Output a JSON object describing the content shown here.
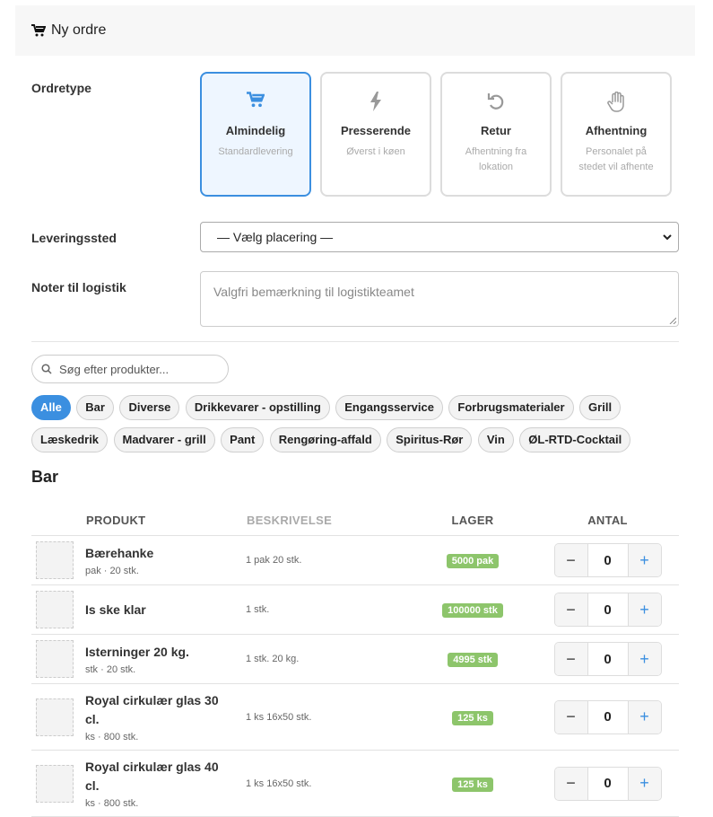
{
  "header": {
    "title": "Ny ordre"
  },
  "order_type": {
    "label": "Ordretype",
    "options": [
      {
        "title": "Almindelig",
        "subtitle": "Standardlevering",
        "icon": "cart-icon",
        "active": true
      },
      {
        "title": "Presserende",
        "subtitle": "Øverst i køen",
        "icon": "lightning-icon",
        "active": false
      },
      {
        "title": "Retur",
        "subtitle": "Afhentning fra lokation",
        "icon": "undo-icon",
        "active": false
      },
      {
        "title": "Afhentning",
        "subtitle": "Personalet på stedet vil afhente",
        "icon": "hand-icon",
        "active": false
      }
    ]
  },
  "delivery": {
    "label": "Leveringssted",
    "selected": "— Vælg placering —"
  },
  "notes": {
    "label": "Noter til logistik",
    "placeholder": "Valgfri bemærkning til logistikteamet"
  },
  "search": {
    "placeholder": "Søg efter produkter..."
  },
  "categories": [
    "Alle",
    "Bar",
    "Diverse",
    "Drikkevarer - opstilling",
    "Engangsservice",
    "Forbrugsmaterialer",
    "Grill",
    "Læskedrik",
    "Madvarer - grill",
    "Pant",
    "Rengøring-affald",
    "Spiritus-Rør",
    "Vin",
    "ØL-RTD-Cocktail"
  ],
  "active_category": "Alle",
  "section": {
    "title": "Bar"
  },
  "table": {
    "headers": {
      "product": "PRODUKT",
      "description": "BESKRIVELSE",
      "stock": "LAGER",
      "quantity": "ANTAL"
    },
    "rows": [
      {
        "name": "Bærehanke",
        "meta": "pak · 20 stk.",
        "description": "1 pak 20 stk.",
        "stock": "5000 pak",
        "qty": "0"
      },
      {
        "name": "Is ske klar",
        "meta": "",
        "description": "1 stk.",
        "stock": "100000 stk",
        "qty": "0"
      },
      {
        "name": "Isterninger 20 kg.",
        "meta": "stk · 20 stk.",
        "description": "1 stk. 20 kg.",
        "stock": "4995 stk",
        "qty": "0"
      },
      {
        "name": "Royal cirkulær glas 30 cl.",
        "meta": "ks · 800 stk.",
        "description": "1 ks 16x50 stk.",
        "stock": "125 ks",
        "qty": "0"
      },
      {
        "name": "Royal cirkulær glas 40 cl.",
        "meta": "ks · 800 stk.",
        "description": "1 ks 16x50 stk.",
        "stock": "125 ks",
        "qty": "0"
      }
    ]
  },
  "stepper": {
    "minus": "−",
    "plus": "+"
  },
  "colors": {
    "accent": "#3b8fe0",
    "stock_badge": "#8dc56b"
  }
}
